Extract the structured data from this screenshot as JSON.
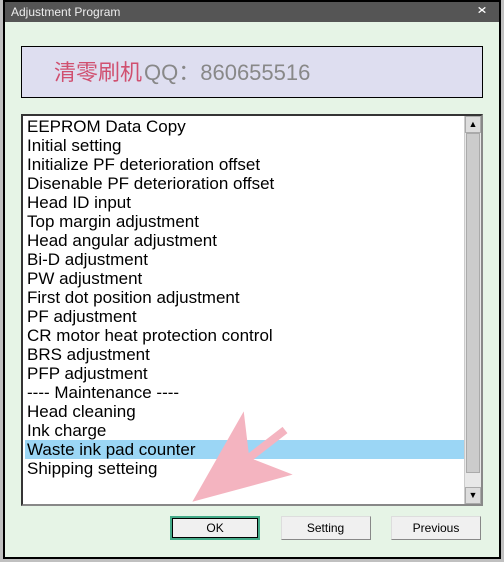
{
  "window": {
    "title": "Adjustment Program"
  },
  "banner": {
    "part1": "清零刷机",
    "part2": "QQ：860655516"
  },
  "list": {
    "items": [
      {
        "label": "EEPROM Data Copy",
        "selected": false
      },
      {
        "label": "Initial setting",
        "selected": false
      },
      {
        "label": "Initialize PF deterioration offset",
        "selected": false
      },
      {
        "label": "Disenable PF deterioration offset",
        "selected": false
      },
      {
        "label": "Head ID input",
        "selected": false
      },
      {
        "label": "Top margin adjustment",
        "selected": false
      },
      {
        "label": "Head angular adjustment",
        "selected": false
      },
      {
        "label": "Bi-D adjustment",
        "selected": false
      },
      {
        "label": "PW adjustment",
        "selected": false
      },
      {
        "label": "First dot position adjustment",
        "selected": false
      },
      {
        "label": "PF adjustment",
        "selected": false
      },
      {
        "label": "CR motor heat protection control",
        "selected": false
      },
      {
        "label": "BRS adjustment",
        "selected": false
      },
      {
        "label": "PFP adjustment",
        "selected": false
      },
      {
        "label": " ",
        "selected": false
      },
      {
        "label": "---- Maintenance ----",
        "selected": false
      },
      {
        "label": "Head cleaning",
        "selected": false
      },
      {
        "label": "Ink charge",
        "selected": false
      },
      {
        "label": "Waste ink pad counter",
        "selected": true
      },
      {
        "label": "Shipping setteing",
        "selected": false
      }
    ]
  },
  "buttons": {
    "ok": "OK",
    "setting": "Setting",
    "previous": "Previous"
  }
}
